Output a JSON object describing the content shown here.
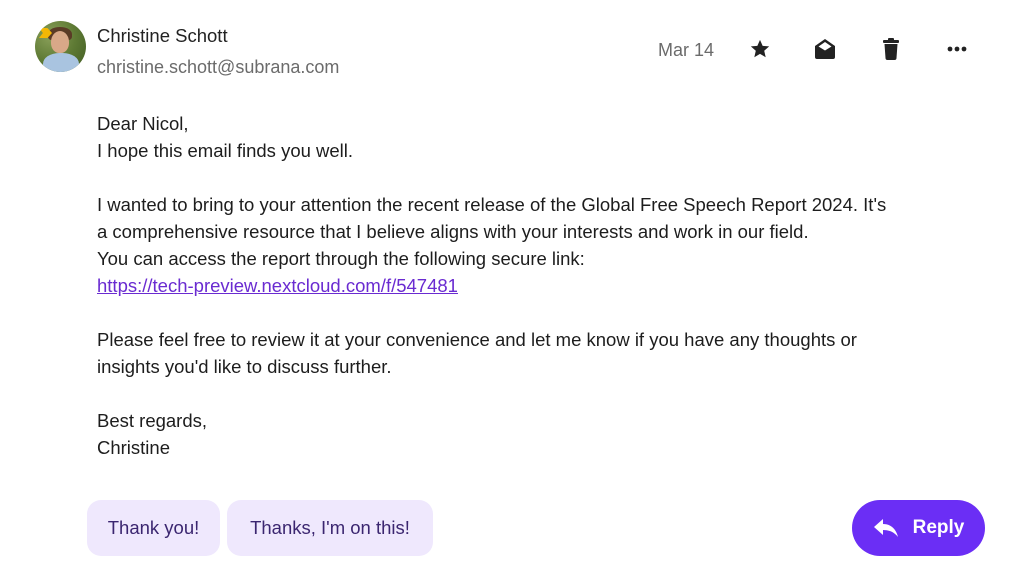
{
  "sender": {
    "name": "Christine Schott",
    "email": "christine.schott@subrana.com",
    "avatar": "avatar-photo"
  },
  "header": {
    "date": "Mar 14",
    "actions": [
      {
        "name": "star",
        "icon": "star-icon"
      },
      {
        "name": "mark-read",
        "icon": "envelope-open-icon"
      },
      {
        "name": "delete",
        "icon": "trash-icon"
      },
      {
        "name": "more",
        "icon": "more-horizontal-icon"
      }
    ]
  },
  "email": {
    "greeting": "Dear Nicol,",
    "line1": "I hope this email finds you well.",
    "para2_l1": "I wanted to bring to your attention the recent release of the Global Free Speech Report 2024. It's",
    "para2_l2": "a comprehensive resource that I believe aligns with your interests and work in our field.",
    "para2_l3": "You can access the report through the following secure link:",
    "link": "https://tech-preview.nextcloud.com/f/547481",
    "para3_l1": "Please feel free to review it at your convenience and let me know if you have any thoughts or",
    "para3_l2": "insights you'd like to discuss further.",
    "closing": "Best regards,",
    "signature": "Christine"
  },
  "quick_replies": [
    "Thank you!",
    "Thanks, I'm on this!"
  ],
  "reply_button": {
    "label": "Reply",
    "icon": "reply-arrow-icon"
  },
  "colors": {
    "accent": "#6b2ef5",
    "chip_bg": "#efe8fd",
    "link": "#6a2bd1"
  }
}
